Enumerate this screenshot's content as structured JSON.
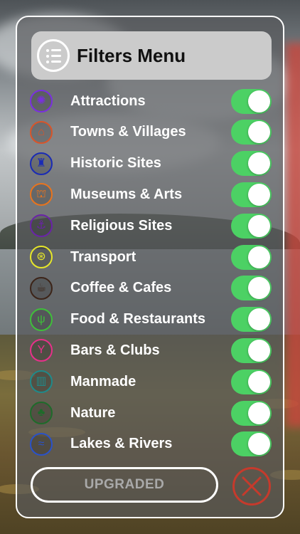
{
  "header": {
    "title": "Filters Menu",
    "icon": "menu-list-icon"
  },
  "filters": [
    {
      "label": "Attractions",
      "icon": "star-burst-icon",
      "color": "#7a2fe0",
      "enabled": true
    },
    {
      "label": "Towns & Villages",
      "icon": "houses-icon",
      "color": "#d8552a",
      "enabled": true
    },
    {
      "label": "Historic Sites",
      "icon": "castle-tower-icon",
      "color": "#1a2bb5",
      "enabled": true
    },
    {
      "label": "Museums & Arts",
      "icon": "museum-icon",
      "color": "#e8741e",
      "enabled": true
    },
    {
      "label": "Religious Sites",
      "icon": "anchor-cross-icon",
      "color": "#6a23a8",
      "enabled": true
    },
    {
      "label": "Transport",
      "icon": "wheel-icon",
      "color": "#e6e62a",
      "enabled": true
    },
    {
      "label": "Coffee & Cafes",
      "icon": "coffee-cup-icon",
      "color": "#3c2418",
      "enabled": true
    },
    {
      "label": "Food & Restaurants",
      "icon": "fork-knife-icon",
      "color": "#3fbf3a",
      "enabled": true
    },
    {
      "label": "Bars & Clubs",
      "icon": "cocktail-glass-icon",
      "color": "#e8308a",
      "enabled": true
    },
    {
      "label": "Manmade",
      "icon": "buildings-icon",
      "color": "#1f8a8a",
      "enabled": true
    },
    {
      "label": "Nature",
      "icon": "tree-icon",
      "color": "#1e6b2a",
      "enabled": true
    },
    {
      "label": "Lakes & Rivers",
      "icon": "waves-icon",
      "color": "#2a52c9",
      "enabled": true
    }
  ],
  "footer": {
    "upgrade_label": "UPGRADED",
    "close_icon": "close-x-icon"
  },
  "colors": {
    "toggle_on": "#4cd164",
    "close": "#c63a2c",
    "panel_border": "#ffffff"
  }
}
